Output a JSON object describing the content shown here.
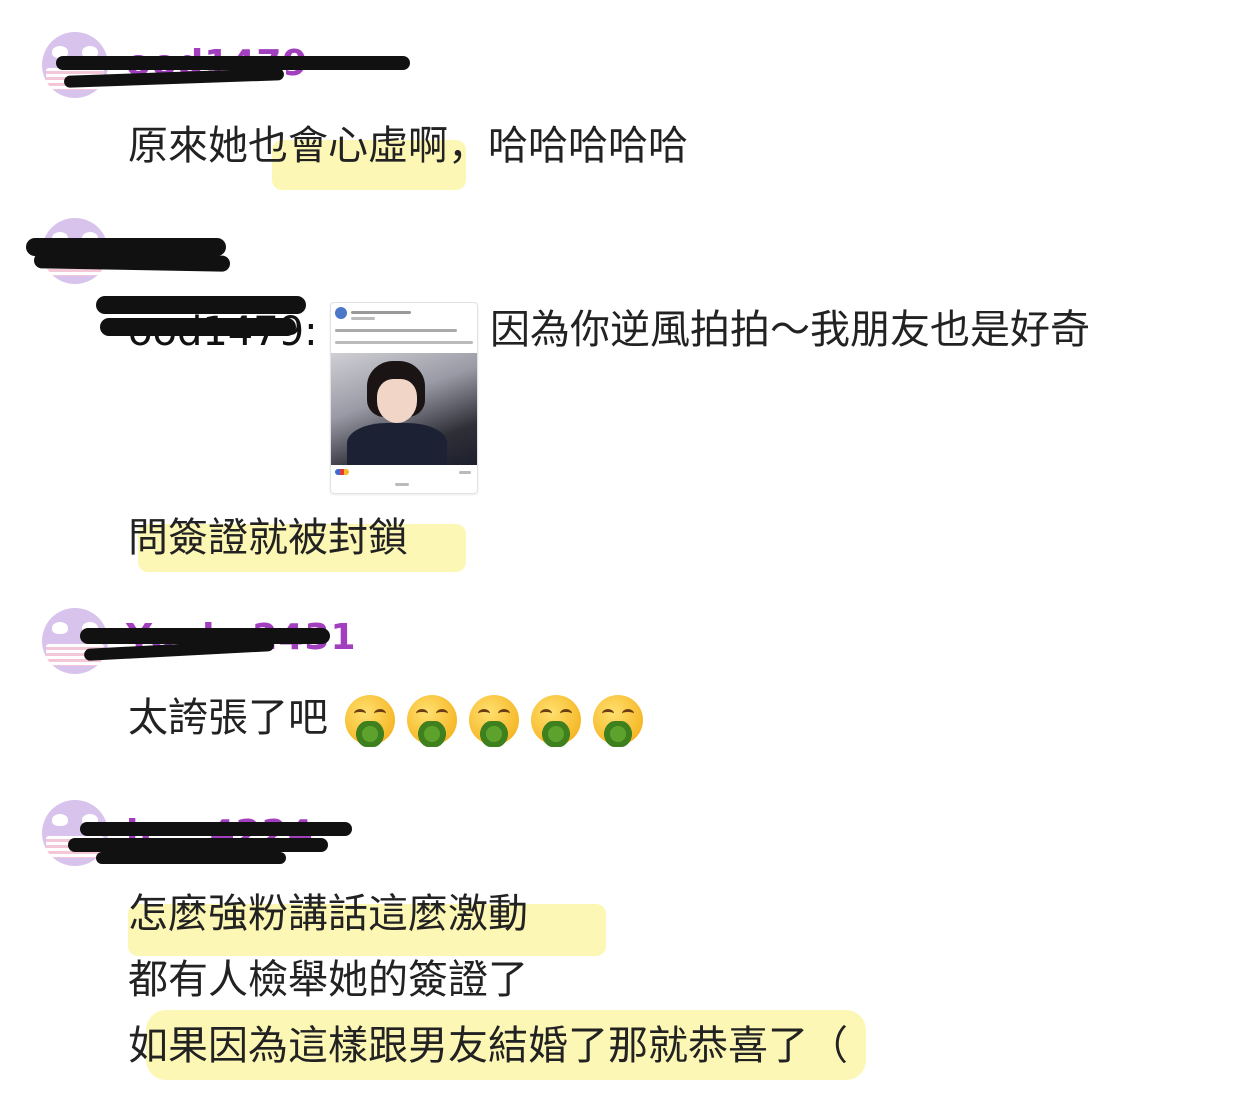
{
  "comments": [
    {
      "username": "ood1479",
      "lines": [
        "原來她也會心虛啊，哈哈哈哈哈"
      ]
    },
    {
      "username": "",
      "reply_to": "ood1479:",
      "reply_text": "因為你逆風拍拍～我朋友也是好奇",
      "lines": [
        "問簽證就被封鎖"
      ]
    },
    {
      "username": "Youka2431",
      "lines": [
        "太誇張了吧"
      ],
      "emoji_count": 5,
      "emoji": "nauseated-vomiting-face"
    },
    {
      "username": "h___4224",
      "lines": [
        "怎麼強粉講話這麼激動",
        "都有人檢舉她的簽證了",
        "如果因為這樣跟男友結婚了那就恭喜了（"
      ]
    }
  ],
  "colors": {
    "username": "#a23fbf",
    "highlight": "#fbf6a8",
    "redaction": "#111111",
    "avatar_bg": "#d7c3ec"
  }
}
